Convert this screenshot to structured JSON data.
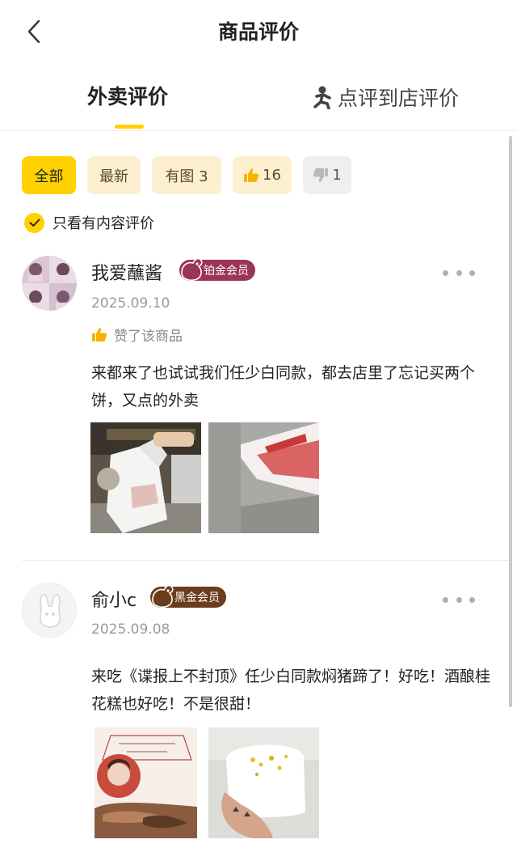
{
  "nav": {
    "title": "商品评价",
    "back_icon": "chevron-left-icon"
  },
  "tabs": {
    "delivery_label": "外卖评价",
    "store_label": "点评到店评价",
    "store_icon": "walking-person-icon"
  },
  "filters": [
    {
      "label": "全部"
    },
    {
      "label": "最新"
    },
    {
      "label": "有图 3"
    },
    {
      "label": "16",
      "icon": "thumbs-up-icon"
    },
    {
      "label": "1",
      "icon": "thumbs-down-icon"
    }
  ],
  "only_content": {
    "label": "只看有内容评价",
    "checked": true
  },
  "reviews": [
    {
      "username": "我爱蘸酱",
      "badge": "铂金会员",
      "badge_color": "#9a3555",
      "date": "2025.09.10",
      "liked_text": "赞了该商品",
      "content": "来都来了也试试我们任少白同款，都去店里了忘记买两个饼，又点的外卖",
      "photos": 2
    },
    {
      "username": "俞小c",
      "badge": "黑金会员",
      "badge_color": "#6b3d1c",
      "date": "2025.09.08",
      "content": "来吃《谍报上不封顶》任少白同款焖猪蹄了！好吃！酒酿桂花糕也好吃！不是很甜！",
      "photos": 2
    }
  ],
  "colors": {
    "accent": "#ffd100",
    "chip_bg": "#fdf0d0"
  }
}
